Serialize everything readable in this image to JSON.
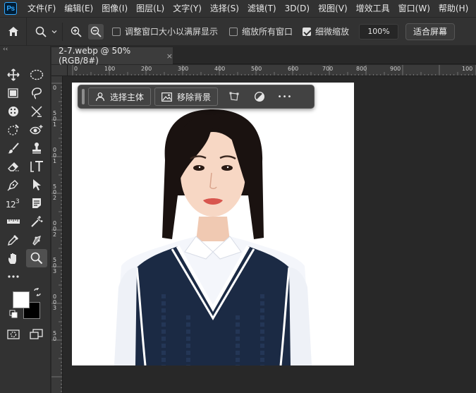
{
  "app": {
    "logo_text": "Ps"
  },
  "menu": [
    "文件(F)",
    "编辑(E)",
    "图像(I)",
    "图层(L)",
    "文字(Y)",
    "选择(S)",
    "滤镜(T)",
    "3D(D)",
    "视图(V)",
    "增效工具",
    "窗口(W)",
    "帮助(H)"
  ],
  "options": {
    "resize_windows_label": "调整窗口大小以满屏显示",
    "resize_windows_checked": false,
    "zoom_all_label": "缩放所有窗口",
    "zoom_all_checked": false,
    "scrubby_label": "细微缩放",
    "scrubby_checked": true,
    "zoom_value": "100%",
    "fit_screen_label": "适合屏幕"
  },
  "toolbar": {
    "collapse_glyph": "‹‹"
  },
  "document": {
    "tab_title": "2-7.webp @ 50%(RGB/8#)",
    "close_glyph": "×"
  },
  "ruler_h": [
    "0",
    "100",
    "200",
    "300",
    "400",
    "500",
    "600",
    "700",
    "800",
    "900",
    "100"
  ],
  "ruler_v": [
    "0",
    "5",
    "0",
    "1",
    "0",
    "0",
    "1",
    "5",
    "0",
    "2",
    "0",
    "0",
    "2",
    "5",
    "0",
    "3",
    "0",
    "0",
    "3",
    "5",
    "0"
  ],
  "taskbar": {
    "select_subject_label": "选择主体",
    "remove_bg_label": "移除背景",
    "more_glyph": "•••"
  },
  "colors": {
    "foreground": "#ffffff",
    "background": "#000000",
    "ui_panel": "#323232",
    "pasteboard": "#282828",
    "accent": "#31a8ff"
  }
}
